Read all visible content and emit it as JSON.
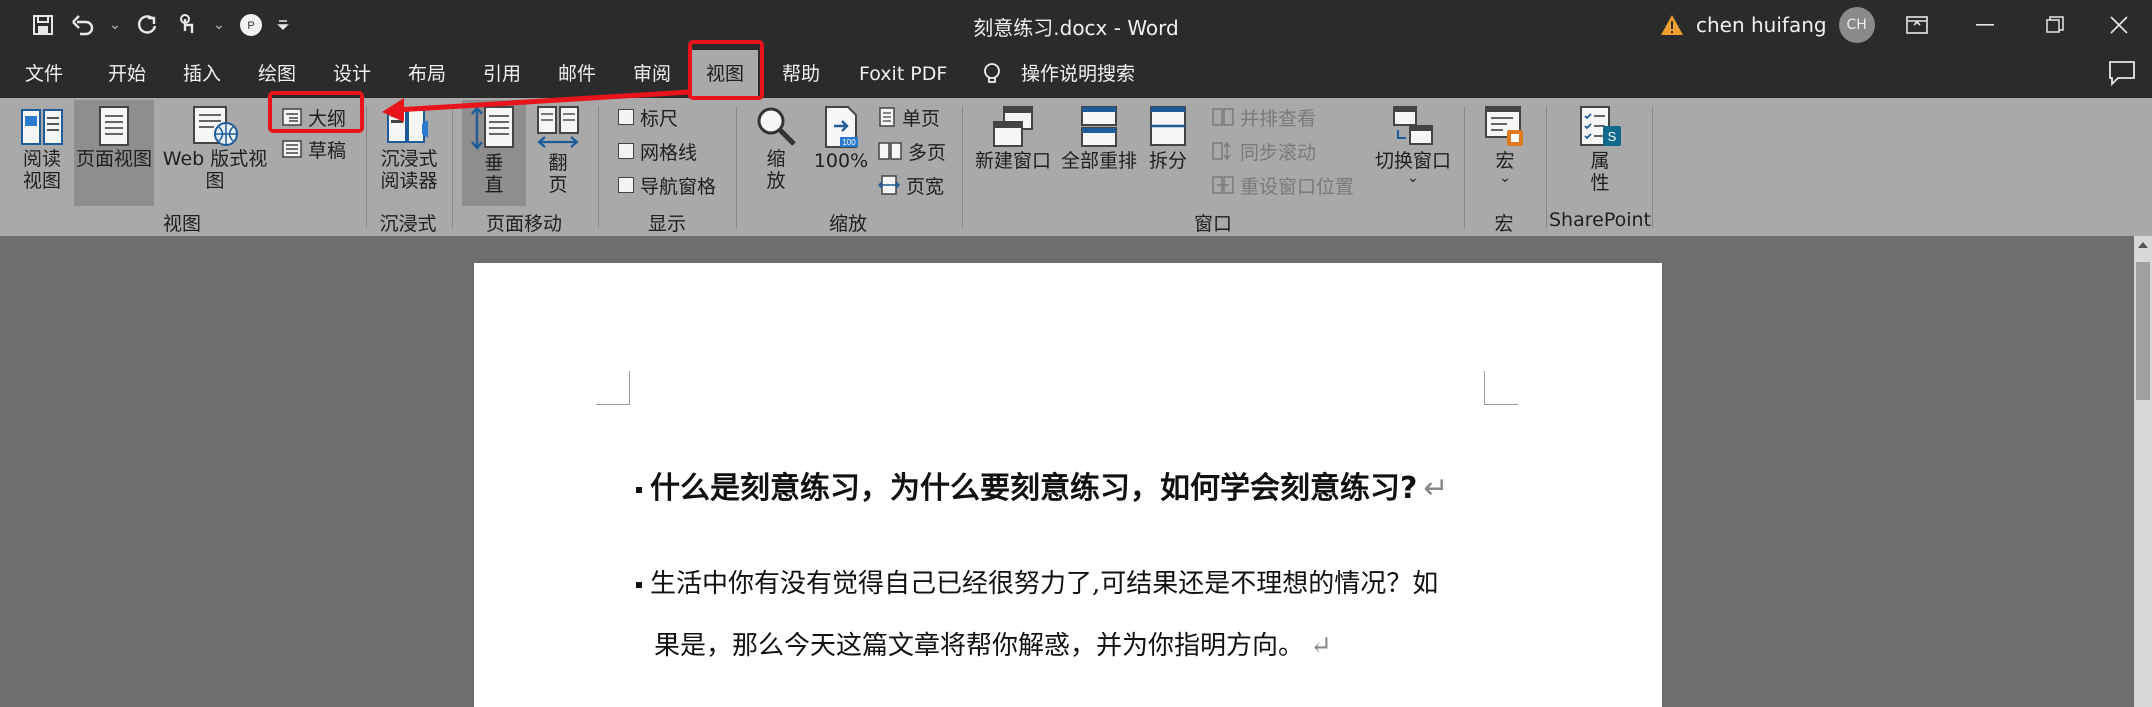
{
  "window": {
    "title": "刻意练习.docx  -  Word",
    "user_name": "chen huifang",
    "avatar_initials": "CH",
    "warning_icon": "warning-icon"
  },
  "tabs": [
    "文件",
    "开始",
    "插入",
    "绘图",
    "设计",
    "布局",
    "引用",
    "邮件",
    "审阅",
    "视图",
    "帮助",
    "Foxit PDF",
    "操作说明搜索"
  ],
  "active_tab": "视图",
  "ribbon": {
    "views": {
      "read_mode_l1": "阅读",
      "read_mode_l2": "视图",
      "print_layout": "页面视图",
      "web_layout": "Web 版式视图",
      "outline": "大纲",
      "draft": "草稿",
      "group_label": "视图"
    },
    "immersive": {
      "reader_l1": "沉浸式",
      "reader_l2": "阅读器",
      "group_label": "沉浸式"
    },
    "page_movement": {
      "vertical_l1": "垂",
      "vertical_l2": "直",
      "side_l1": "翻",
      "side_l2": "页",
      "group_label": "页面移动"
    },
    "show": {
      "ruler": "标尺",
      "gridlines": "网格线",
      "nav_pane": "导航窗格",
      "group_label": "显示",
      "ruler_checked": false,
      "gridlines_checked": false,
      "nav_pane_checked": false
    },
    "zoom": {
      "zoom_l1": "缩",
      "zoom_l2": "放",
      "hundred": "100%",
      "one_page": "单页",
      "multi_page": "多页",
      "page_width": "页宽",
      "group_label": "缩放"
    },
    "window": {
      "new_window": "新建窗口",
      "arrange_all": "全部重排",
      "split": "拆分",
      "side_by_side": "并排查看",
      "sync_scroll": "同步滚动",
      "reset_position": "重设窗口位置",
      "switch_windows": "切换窗口",
      "group_label": "窗口"
    },
    "macros": {
      "macros": "宏",
      "group_label": "宏"
    },
    "sharepoint": {
      "props_l1": "属",
      "props_l2": "性",
      "group_label": "SharePoint"
    }
  },
  "document": {
    "heading": "什么是刻意练习，为什么要刻意练习，如何学会刻意练习?",
    "para_line1": "生活中你有没有觉得自己已经很努力了,可结果还是不理想的情况？如",
    "para_line2": "果是，那么今天这篇文章将帮你解惑，并为你指明方向。",
    "para_mark": "↵"
  },
  "colors": {
    "highlight": "#e8141b",
    "titlebar": "#2b2b2b",
    "ribbon": "#a9a9a9",
    "canvas": "#6e6e6e"
  }
}
